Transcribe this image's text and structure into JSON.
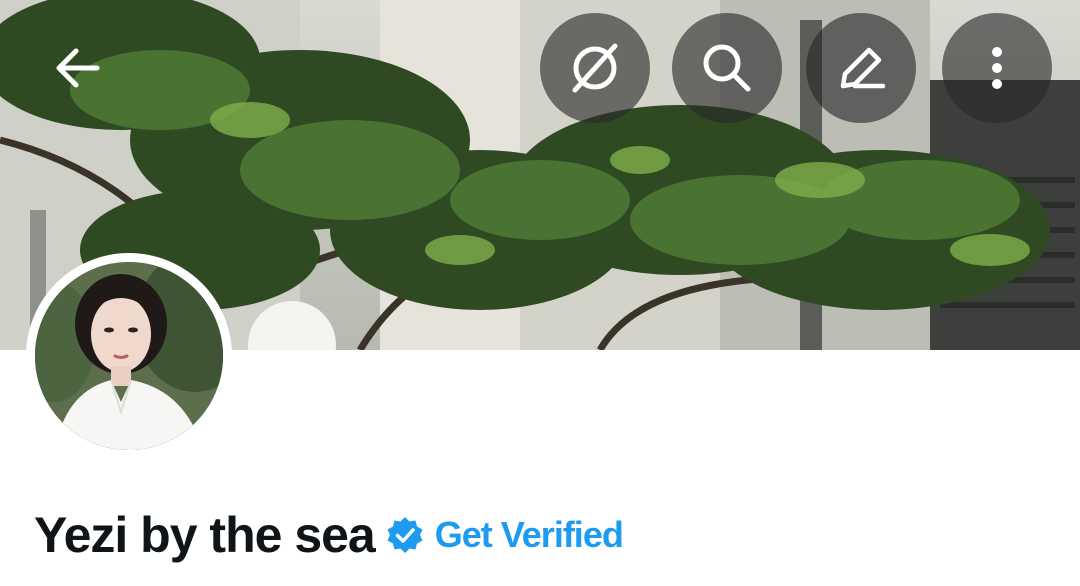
{
  "header": {
    "back_icon": "arrow-left-icon",
    "actions": [
      {
        "icon": "grok-icon",
        "label": "Grok"
      },
      {
        "icon": "search-icon",
        "label": "Search"
      },
      {
        "icon": "edit-icon",
        "label": "Edit"
      },
      {
        "icon": "more-vertical-icon",
        "label": "More"
      }
    ]
  },
  "profile": {
    "display_name": "Yezi by the sea",
    "verified_badge_icon": "verified-badge-icon",
    "get_verified_label": "Get Verified"
  },
  "colors": {
    "accent": "#1d9bf0",
    "text": "#0f1419",
    "button_overlay": "#282828"
  }
}
